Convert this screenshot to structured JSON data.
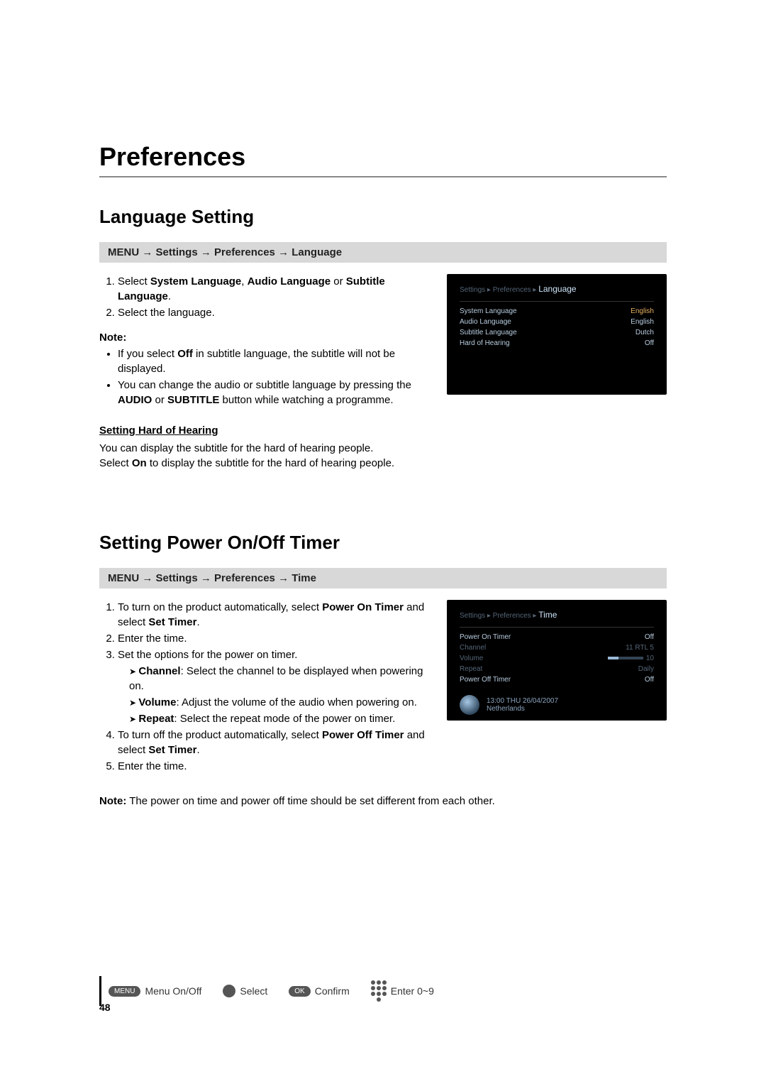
{
  "page_title": "Preferences",
  "section1": {
    "heading": "Language Setting",
    "nav_path": "MENU → Settings → Preferences → Language",
    "step1_a": "Select ",
    "step1_b": "System Language",
    "step1_c": ", ",
    "step1_d": "Audio Language",
    "step1_e": " or ",
    "step1_f": "Subtitle Language",
    "step1_g": ".",
    "step2": "Select the language.",
    "note_label": "Note:",
    "bullet1_a": "If you select ",
    "bullet1_b": "Off",
    "bullet1_c": " in subtitle language, the subtitle will not be displayed.",
    "bullet2_a": "You can change the audio or subtitle language by pressing the ",
    "bullet2_b": "AUDIO",
    "bullet2_c": " or ",
    "bullet2_d": "SUBTITLE",
    "bullet2_e": " button while watching a programme.",
    "sub_heading": "Setting Hard of Hearing",
    "body_a": "You can display the subtitle for the hard of hearing people.",
    "body_b_a": "Select ",
    "body_b_b": "On",
    "body_b_c": " to display the subtitle for the hard of hearing people.",
    "screenshot": {
      "bc_prefix": "Settings ▸ Preferences ▸ ",
      "bc_current": "Language",
      "rows": [
        {
          "label": "System Language",
          "value": "English"
        },
        {
          "label": "Audio Language",
          "value": "English"
        },
        {
          "label": "Subtitle Language",
          "value": "Dutch"
        },
        {
          "label": "Hard of Hearing",
          "value": "Off"
        }
      ]
    }
  },
  "section2": {
    "heading": "Setting Power On/Off Timer",
    "nav_path": "MENU → Settings → Preferences → Time",
    "step1_a": "To turn on the product automatically, select ",
    "step1_b": "Power On Timer",
    "step1_c": " and select ",
    "step1_d": "Set Timer",
    "step1_e": ".",
    "step2": "Enter the time.",
    "step3": "Set the options for the power on timer.",
    "opt1_a": "Channel",
    "opt1_b": ": Select the channel to be displayed when powering on.",
    "opt2_a": "Volume",
    "opt2_b": ": Adjust the volume of the audio when powering on.",
    "opt3_a": "Repeat",
    "opt3_b": ": Select the repeat mode of the power on timer.",
    "step4_a": "To turn off the product automatically, select ",
    "step4_b": "Power Off Timer",
    "step4_c": " and select ",
    "step4_d": "Set Timer",
    "step4_e": ".",
    "step5": "Enter the time.",
    "final_note_a": "Note:",
    "final_note_b": "   The power on time and power off time should be set different from each other.",
    "screenshot": {
      "bc_prefix": "Settings ▸ Preferences ▸ ",
      "bc_current": "Time",
      "rows": [
        {
          "label": "Power On Timer",
          "value": "Off"
        },
        {
          "label": "Channel",
          "value": "11 RTL 5"
        },
        {
          "label": "Volume",
          "value": "10"
        },
        {
          "label": "Repeat",
          "value": "Daily"
        },
        {
          "label": "Power Off Timer",
          "value": "Off"
        }
      ],
      "clock_line1": "13:00 THU 26/04/2007",
      "clock_line2": "Netherlands"
    }
  },
  "footer": {
    "page_number": "48",
    "menu_btn": "MENU",
    "menu_label": "Menu On/Off",
    "select_label": "Select",
    "ok_btn": "OK",
    "confirm_label": "Confirm",
    "enter_label": "Enter 0~9"
  }
}
